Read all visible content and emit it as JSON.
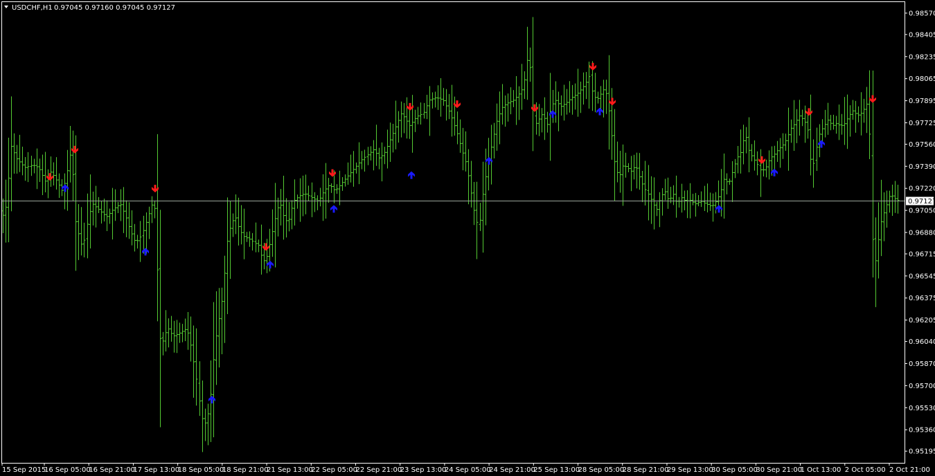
{
  "header": {
    "symbol": "USDCHF,H1",
    "ohlc": "0.97045 0.97160 0.97045 0.97127"
  },
  "colors": {
    "background": "#000000",
    "axis": "#ffffff",
    "bar": "#55cc33",
    "bid_line": "#9aa69a",
    "arrow_up": "#1a1aff",
    "arrow_down": "#ff1a1a"
  },
  "chart_data": {
    "type": "bar",
    "ylim": [
      0.95105,
      0.98655
    ],
    "y_ticks": [
      "0.98570",
      "0.98405",
      "0.98235",
      "0.98065",
      "0.97895",
      "0.97725",
      "0.97560",
      "0.97390",
      "0.97220",
      "0.97050",
      "0.96880",
      "0.96715",
      "0.96545",
      "0.96375",
      "0.96205",
      "0.96040",
      "0.95870",
      "0.95700",
      "0.95530",
      "0.95360",
      "0.95195"
    ],
    "x_ticks": [
      "15 Sep 2015",
      "16 Sep 05:00",
      "16 Sep 21:00",
      "17 Sep 13:00",
      "18 Sep 05:00",
      "18 Sep 21:00",
      "21 Sep 13:00",
      "22 Sep 05:00",
      "22 Sep 21:00",
      "23 Sep 13:00",
      "24 Sep 05:00",
      "24 Sep 21:00",
      "25 Sep 13:00",
      "28 Sep 05:00",
      "28 Sep 21:00",
      "29 Sep 13:00",
      "30 Sep 05:00",
      "30 Sep 21:00",
      "1 Oct 13:00",
      "2 Oct 05:00",
      "2 Oct 21:00"
    ],
    "current_price": "0.97127",
    "current_price_value": 0.97127,
    "bar_count": 320,
    "shape_points": [
      [
        0,
        0.9705
      ],
      [
        6,
        0.97
      ],
      [
        10,
        0.9712
      ],
      [
        16,
        0.9755
      ],
      [
        24,
        0.9745
      ],
      [
        36,
        0.9738
      ],
      [
        48,
        0.974
      ],
      [
        56,
        0.9738
      ],
      [
        66,
        0.9727
      ],
      [
        74,
        0.9735
      ],
      [
        82,
        0.9728
      ],
      [
        90,
        0.972
      ],
      [
        96,
        0.973
      ],
      [
        100,
        0.9745
      ],
      [
        104,
        0.9752
      ],
      [
        108,
        0.97
      ],
      [
        112,
        0.969
      ],
      [
        118,
        0.9678
      ],
      [
        124,
        0.9685
      ],
      [
        128,
        0.97
      ],
      [
        134,
        0.971
      ],
      [
        144,
        0.9705
      ],
      [
        154,
        0.97
      ],
      [
        164,
        0.9706
      ],
      [
        174,
        0.971
      ],
      [
        182,
        0.97
      ],
      [
        188,
        0.969
      ],
      [
        196,
        0.968
      ],
      [
        202,
        0.9684
      ],
      [
        208,
        0.969
      ],
      [
        214,
        0.97
      ],
      [
        220,
        0.971
      ],
      [
        225,
        0.9705
      ],
      [
        228,
        0.965
      ],
      [
        232,
        0.96
      ],
      [
        236,
        0.9605
      ],
      [
        242,
        0.9615
      ],
      [
        250,
        0.9608
      ],
      [
        258,
        0.961
      ],
      [
        264,
        0.9612
      ],
      [
        270,
        0.9614
      ],
      [
        276,
        0.96
      ],
      [
        282,
        0.958
      ],
      [
        288,
        0.956
      ],
      [
        292,
        0.9545
      ],
      [
        298,
        0.954
      ],
      [
        304,
        0.956
      ],
      [
        310,
        0.96
      ],
      [
        316,
        0.962
      ],
      [
        322,
        0.964
      ],
      [
        328,
        0.968
      ],
      [
        334,
        0.9695
      ],
      [
        340,
        0.97
      ],
      [
        346,
        0.969
      ],
      [
        352,
        0.9685
      ],
      [
        360,
        0.9683
      ],
      [
        368,
        0.968
      ],
      [
        374,
        0.9678
      ],
      [
        380,
        0.9665
      ],
      [
        386,
        0.967
      ],
      [
        392,
        0.9685
      ],
      [
        398,
        0.97
      ],
      [
        404,
        0.9712
      ],
      [
        410,
        0.97
      ],
      [
        416,
        0.9695
      ],
      [
        424,
        0.9712
      ],
      [
        432,
        0.9716
      ],
      [
        440,
        0.9718
      ],
      [
        450,
        0.9715
      ],
      [
        460,
        0.9712
      ],
      [
        468,
        0.972
      ],
      [
        476,
        0.9725
      ],
      [
        484,
        0.972
      ],
      [
        492,
        0.9725
      ],
      [
        500,
        0.973
      ],
      [
        508,
        0.9735
      ],
      [
        516,
        0.974
      ],
      [
        524,
        0.9745
      ],
      [
        532,
        0.9748
      ],
      [
        540,
        0.9752
      ],
      [
        548,
        0.9745
      ],
      [
        556,
        0.975
      ],
      [
        564,
        0.976
      ],
      [
        572,
        0.977
      ],
      [
        580,
        0.978
      ],
      [
        586,
        0.9775
      ],
      [
        592,
        0.977
      ],
      [
        598,
        0.9775
      ],
      [
        604,
        0.9778
      ],
      [
        612,
        0.978
      ],
      [
        620,
        0.979
      ],
      [
        630,
        0.9792
      ],
      [
        640,
        0.979
      ],
      [
        650,
        0.978
      ],
      [
        660,
        0.9765
      ],
      [
        668,
        0.975
      ],
      [
        674,
        0.974
      ],
      [
        680,
        0.972
      ],
      [
        686,
        0.97
      ],
      [
        692,
        0.969
      ],
      [
        698,
        0.972
      ],
      [
        706,
        0.9745
      ],
      [
        712,
        0.976
      ],
      [
        718,
        0.9775
      ],
      [
        726,
        0.9785
      ],
      [
        734,
        0.9788
      ],
      [
        742,
        0.979
      ],
      [
        750,
        0.9795
      ],
      [
        756,
        0.98
      ],
      [
        760,
        0.9815
      ],
      [
        764,
        0.983
      ],
      [
        768,
        0.979
      ],
      [
        772,
        0.977
      ],
      [
        778,
        0.9775
      ],
      [
        784,
        0.978
      ],
      [
        790,
        0.977
      ],
      [
        796,
        0.9785
      ],
      [
        802,
        0.979
      ],
      [
        810,
        0.9785
      ],
      [
        818,
        0.9788
      ],
      [
        826,
        0.9792
      ],
      [
        834,
        0.9795
      ],
      [
        842,
        0.98
      ],
      [
        848,
        0.9805
      ],
      [
        852,
        0.981
      ],
      [
        856,
        0.9795
      ],
      [
        862,
        0.979
      ],
      [
        868,
        0.9795
      ],
      [
        874,
        0.98
      ],
      [
        880,
        0.978
      ],
      [
        884,
        0.976
      ],
      [
        888,
        0.974
      ],
      [
        894,
        0.973
      ],
      [
        900,
        0.974
      ],
      [
        906,
        0.9738
      ],
      [
        912,
        0.9735
      ],
      [
        918,
        0.974
      ],
      [
        924,
        0.973
      ],
      [
        930,
        0.9722
      ],
      [
        936,
        0.9718
      ],
      [
        942,
        0.9712
      ],
      [
        948,
        0.9705
      ],
      [
        954,
        0.9715
      ],
      [
        960,
        0.972
      ],
      [
        966,
        0.9712
      ],
      [
        972,
        0.9718
      ],
      [
        978,
        0.971
      ],
      [
        984,
        0.9715
      ],
      [
        990,
        0.9712
      ],
      [
        996,
        0.9713
      ],
      [
        1004,
        0.971
      ],
      [
        1012,
        0.9712
      ],
      [
        1020,
        0.971
      ],
      [
        1028,
        0.9708
      ],
      [
        1034,
        0.9712
      ],
      [
        1040,
        0.9718
      ],
      [
        1046,
        0.973
      ],
      [
        1052,
        0.9725
      ],
      [
        1058,
        0.9735
      ],
      [
        1064,
        0.9745
      ],
      [
        1070,
        0.975
      ],
      [
        1076,
        0.9765
      ],
      [
        1082,
        0.975
      ],
      [
        1088,
        0.9745
      ],
      [
        1094,
        0.974
      ],
      [
        1100,
        0.9735
      ],
      [
        1106,
        0.9738
      ],
      [
        1112,
        0.9745
      ],
      [
        1118,
        0.9748
      ],
      [
        1124,
        0.9752
      ],
      [
        1130,
        0.9755
      ],
      [
        1136,
        0.976
      ],
      [
        1142,
        0.9768
      ],
      [
        1148,
        0.9772
      ],
      [
        1154,
        0.9778
      ],
      [
        1160,
        0.9775
      ],
      [
        1166,
        0.977
      ],
      [
        1170,
        0.9745
      ],
      [
        1174,
        0.974
      ],
      [
        1178,
        0.975
      ],
      [
        1184,
        0.9765
      ],
      [
        1190,
        0.977
      ],
      [
        1196,
        0.9775
      ],
      [
        1202,
        0.977
      ],
      [
        1208,
        0.9772
      ],
      [
        1214,
        0.977
      ],
      [
        1220,
        0.9772
      ],
      [
        1226,
        0.9778
      ],
      [
        1232,
        0.9782
      ],
      [
        1238,
        0.9778
      ],
      [
        1244,
        0.978
      ],
      [
        1250,
        0.9785
      ],
      [
        1254,
        0.979
      ],
      [
        1258,
        0.972
      ],
      [
        1262,
        0.966
      ],
      [
        1266,
        0.967
      ],
      [
        1270,
        0.969
      ],
      [
        1274,
        0.97
      ],
      [
        1278,
        0.9705
      ],
      [
        1282,
        0.9712
      ],
      [
        1286,
        0.9718
      ],
      [
        1290,
        0.9715
      ],
      [
        1296,
        0.97127
      ]
    ],
    "arrows_down": [
      [
        72,
        0.973
      ],
      [
        108,
        0.9751
      ],
      [
        224,
        0.9721
      ],
      [
        384,
        0.9676
      ],
      [
        480,
        0.9733
      ],
      [
        592,
        0.9784
      ],
      [
        660,
        0.9786
      ],
      [
        772,
        0.9783
      ],
      [
        856,
        0.9815
      ],
      [
        884,
        0.9788
      ],
      [
        1100,
        0.9743
      ],
      [
        1168,
        0.978
      ],
      [
        1260,
        0.979
      ]
    ],
    "arrows_up": [
      [
        94,
        0.9723
      ],
      [
        210,
        0.9674
      ],
      [
        306,
        0.956
      ],
      [
        390,
        0.9664
      ],
      [
        482,
        0.9707
      ],
      [
        594,
        0.9733
      ],
      [
        706,
        0.9744
      ],
      [
        798,
        0.978
      ],
      [
        866,
        0.9782
      ],
      [
        1038,
        0.9707
      ],
      [
        1118,
        0.9735
      ],
      [
        1186,
        0.9757
      ]
    ]
  }
}
